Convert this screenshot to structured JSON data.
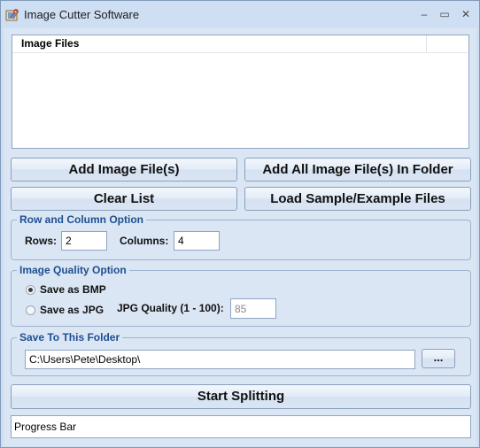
{
  "window": {
    "title": "Image Cutter Software",
    "controls": {
      "minimize": "–",
      "maximize": "▭",
      "close": "✕"
    }
  },
  "file_list": {
    "column_header": "Image Files",
    "items": []
  },
  "buttons": {
    "add_files": "Add Image File(s)",
    "add_all_folder": "Add All Image File(s) In Folder",
    "clear_list": "Clear List",
    "load_sample": "Load Sample/Example Files",
    "start": "Start Splitting",
    "browse": "..."
  },
  "row_column_option": {
    "legend": "Row and Column Option",
    "rows_label": "Rows:",
    "rows_value": "2",
    "columns_label": "Columns:",
    "columns_value": "4"
  },
  "image_quality_option": {
    "legend": "Image Quality Option",
    "save_bmp_label": "Save as BMP",
    "save_bmp_selected": true,
    "save_jpg_label": "Save as JPG",
    "save_jpg_selected": false,
    "jpg_quality_label": "JPG Quality (1 - 100):",
    "jpg_quality_value": "85"
  },
  "save_folder": {
    "legend": "Save To This Folder",
    "path": "C:\\Users\\Pete\\Desktop\\"
  },
  "progress": {
    "label": "Progress Bar"
  },
  "icons": {
    "app": "scissors-app-icon"
  },
  "colors": {
    "legend_text": "#1d4f91",
    "window_bg": "#dbe6f4"
  }
}
